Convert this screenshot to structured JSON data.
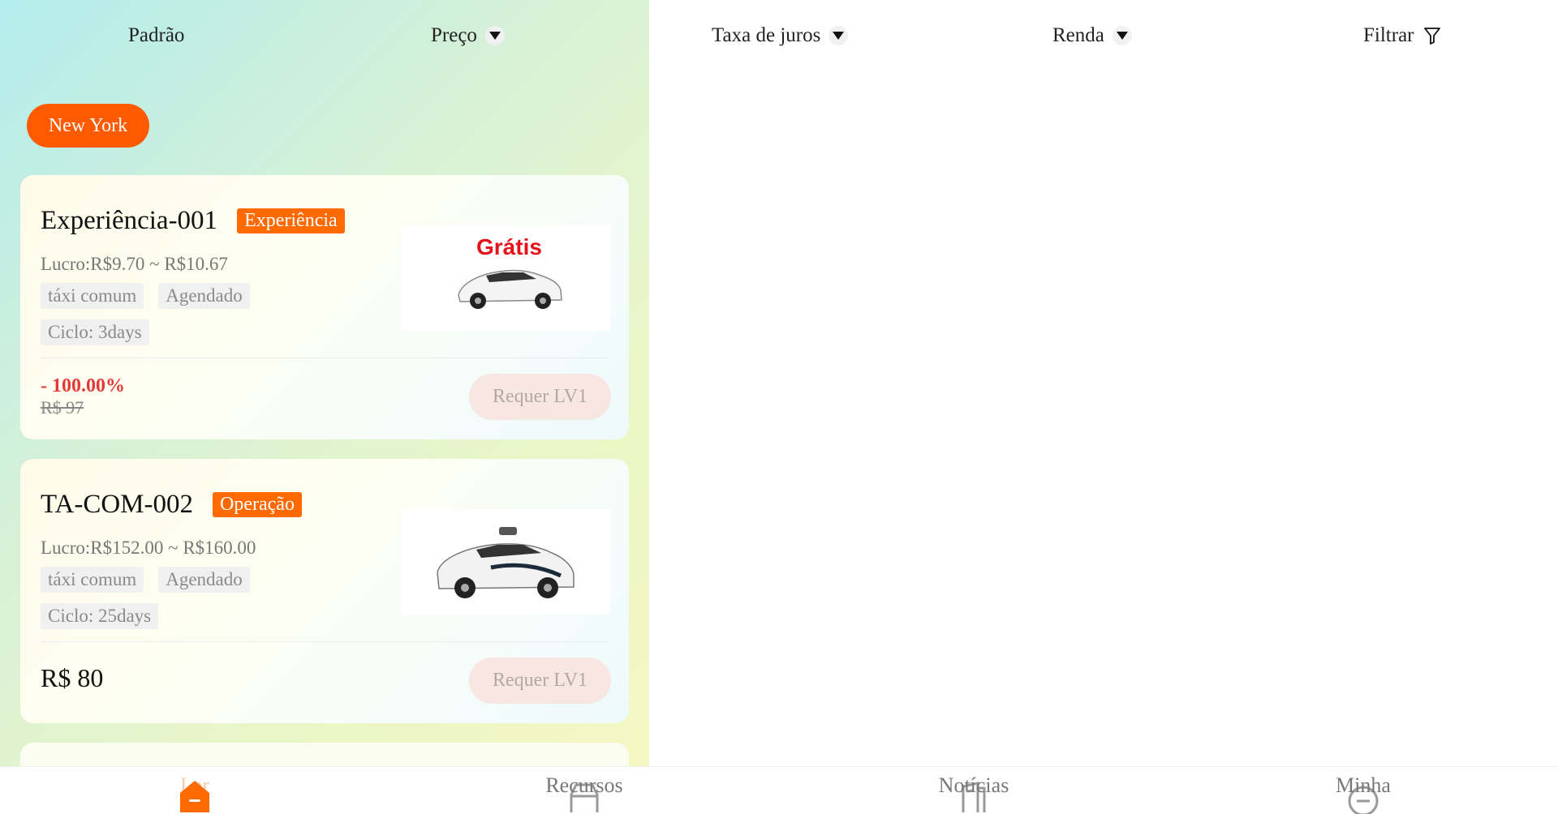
{
  "sort_bar": {
    "items": [
      {
        "label": "Padrão"
      },
      {
        "label": "Preço"
      },
      {
        "label": "Taxa de juros"
      },
      {
        "label": "Renda"
      },
      {
        "label": "Filtrar"
      }
    ]
  },
  "city_filter": {
    "label": "New York"
  },
  "products": [
    {
      "name": "Experiência-001",
      "badge": "Experiência",
      "profit": "Lucro:R$9.70 ~ R$10.67",
      "tags": [
        "táxi comum",
        "Agendado"
      ],
      "cycle": "Ciclo: 3days",
      "image_text": "Grátis",
      "discount": "- 100.00%",
      "original_price": "R$ 97",
      "button": "Requer LV1"
    },
    {
      "name": "TA-COM-002",
      "badge": "Operação",
      "profit": "Lucro:R$152.00 ~ R$160.00",
      "tags": [
        "táxi comum",
        "Agendado"
      ],
      "cycle": "Ciclo: 25days",
      "price": "R$ 80",
      "button": "Requer LV1"
    }
  ],
  "bottom_nav": {
    "items": [
      {
        "label": "Lar",
        "icon": "home-icon",
        "active": true
      },
      {
        "label": "Recursos",
        "icon": "car-icon"
      },
      {
        "label": "Notícias",
        "icon": "news-icon"
      },
      {
        "label": "Minha",
        "icon": "user-icon"
      }
    ]
  },
  "colors": {
    "accent": "#ff5a00",
    "discount": "#e53939"
  }
}
